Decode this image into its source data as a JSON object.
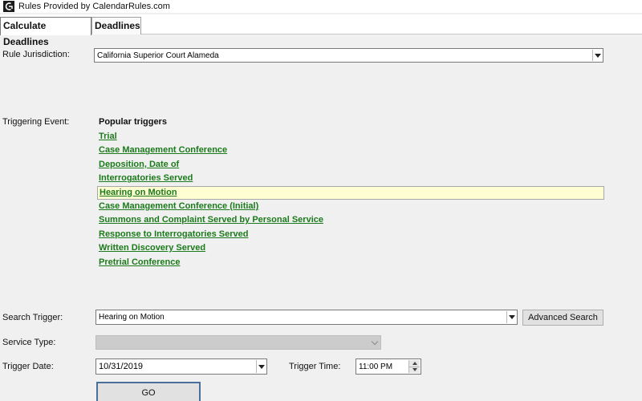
{
  "window": {
    "title": "Rules Provided by CalendarRules.com",
    "icon": "calendarrules-logo-icon"
  },
  "tabs": [
    {
      "label": "Calculate Deadlines",
      "active": true
    },
    {
      "label": "Deadlines",
      "active": false
    }
  ],
  "form": {
    "jurisdiction_label": "Rule Jurisdiction:",
    "jurisdiction_value": "California Superior Court Alameda",
    "triggering_event_label": "Triggering Event:",
    "popular_heading": "Popular triggers",
    "triggers": [
      {
        "label": "Trial",
        "selected": false
      },
      {
        "label": "Case Management Conference",
        "selected": false
      },
      {
        "label": "Deposition, Date of",
        "selected": false
      },
      {
        "label": "Interrogatories Served",
        "selected": false
      },
      {
        "label": "Hearing on Motion",
        "selected": true
      },
      {
        "label": "Case Management Conference (Initial)",
        "selected": false
      },
      {
        "label": "Summons and Complaint Served by Personal Service",
        "selected": false
      },
      {
        "label": "Response to Interrogatories Served",
        "selected": false
      },
      {
        "label": "Written Discovery Served",
        "selected": false
      },
      {
        "label": "Pretrial Conference",
        "selected": false
      }
    ],
    "search_trigger_label": "Search Trigger:",
    "search_trigger_value": "Hearing on Motion",
    "advanced_search_label": "Advanced Search",
    "service_type_label": "Service Type:",
    "service_type_value": "",
    "trigger_date_label": "Trigger Date:",
    "trigger_date_value": "10/31/2019",
    "trigger_time_label": "Trigger Time:",
    "trigger_time_value": "11:00 PM",
    "go_label": "GO"
  },
  "colors": {
    "link": "#1b7a1b",
    "selected_bg": "#fefed2",
    "window_bg": "#f0f0f0"
  }
}
